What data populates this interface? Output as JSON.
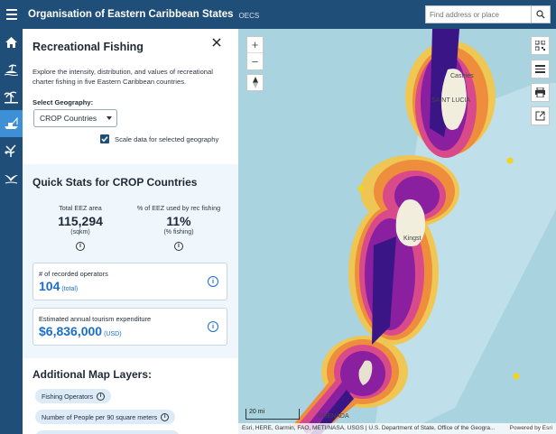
{
  "header": {
    "title": "Organisation of Eastern Caribbean States",
    "subtitle": "OECS",
    "search_placeholder": "Find address or place",
    "colors": {
      "bar": "#1f4e79",
      "accent": "#3d8fd6"
    }
  },
  "rail": {
    "items": [
      {
        "icon": "home-icon"
      },
      {
        "icon": "island-scene-icon"
      },
      {
        "icon": "palm-tree-icon"
      },
      {
        "icon": "boat-fishing-icon",
        "active": true
      },
      {
        "icon": "coral-icon"
      },
      {
        "icon": "seabird-icon"
      }
    ]
  },
  "panel": {
    "title": "Recreational Fishing",
    "intro": "Explore the intensity, distribution, and values of recreational charter fishing in five Eastern Caribbean countries.",
    "geo_label": "Select Geography:",
    "geo_value": "CROP Countries",
    "scale_checkbox_label": "Scale data for selected geography",
    "scale_checked": true,
    "quick_stats_title": "Quick Stats for CROP Countries",
    "stats": [
      {
        "label": "Total EEZ area",
        "value": "115,294",
        "unit": "(sqkm)"
      },
      {
        "label": "% of EEZ used by rec fishing",
        "value": "11%",
        "unit": "(% fishing)"
      }
    ],
    "cards": [
      {
        "label": "# of recorded operators",
        "value": "104",
        "unit": "(total)"
      },
      {
        "label": "Estimated annual tourism expenditure",
        "value": "$6,836,000",
        "unit": "(USD)"
      }
    ],
    "layers_title": "Additional Map Layers:",
    "layers": [
      {
        "label": "Fishing Operators"
      },
      {
        "label": "Number of People per 90 square meters"
      },
      {
        "label": ""
      }
    ],
    "info_glyph": "i"
  },
  "map": {
    "zoom_in": "+",
    "zoom_out": "−",
    "scale_label": "20 mi",
    "places": {
      "castries": "Castries",
      "saint_lucia": "SAINT LUCIA",
      "kingstown": "Kingst",
      "grenada": "GRENADA"
    },
    "attribution": "Esri, HERE, Garmin, FAO, METI/NASA, USGS | U.S. Department of State, Office of the Geogra...",
    "powered_by": "Powered by Esri",
    "tools": [
      "qr-code-icon",
      "basemap-list-icon",
      "print-icon",
      "share-icon"
    ]
  }
}
